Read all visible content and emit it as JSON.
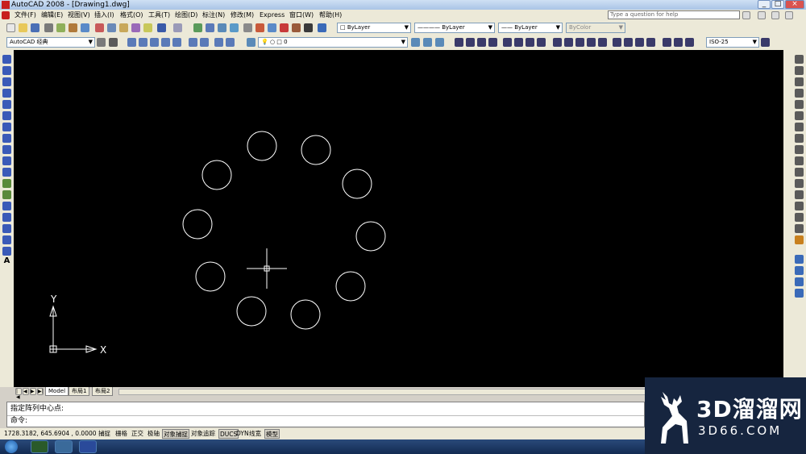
{
  "window": {
    "title": "AutoCAD 2008 - [Drawing1.dwg]"
  },
  "menu": [
    "文件(F)",
    "编辑(E)",
    "视图(V)",
    "插入(I)",
    "格式(O)",
    "工具(T)",
    "绘图(D)",
    "标注(N)",
    "修改(M)",
    "Express",
    "窗口(W)",
    "帮助(H)"
  ],
  "help_search": {
    "placeholder": "Type a question for help"
  },
  "props": {
    "color": "ByLayer",
    "linetype": "ByLayer",
    "lineweight": "ByLayer",
    "plotstyle": "ByColor"
  },
  "workspace": "AutoCAD 经典",
  "layer": "0",
  "dimstyle": "ISO-25",
  "ucs": {
    "x": "X",
    "y": "Y"
  },
  "tabs": [
    "Model",
    "布局1",
    "布局2"
  ],
  "command": {
    "line1": "指定阵列中心点:",
    "line2": "命令:"
  },
  "status": {
    "coords": "1728.3182, 645.6904 , 0.0000",
    "buttons": [
      {
        "label": "捕捉",
        "on": false
      },
      {
        "label": "栅格",
        "on": false
      },
      {
        "label": "正交",
        "on": false
      },
      {
        "label": "极轴",
        "on": false
      },
      {
        "label": "对象捕捉",
        "on": true
      },
      {
        "label": "对象追踪",
        "on": false
      },
      {
        "label": "DUCS",
        "on": true
      },
      {
        "label": "DYN",
        "on": false
      },
      {
        "label": "线宽",
        "on": false
      },
      {
        "label": "模型",
        "on": true
      }
    ]
  },
  "watermark": {
    "brand": "3D溜溜网",
    "url": "3D66.COM"
  }
}
